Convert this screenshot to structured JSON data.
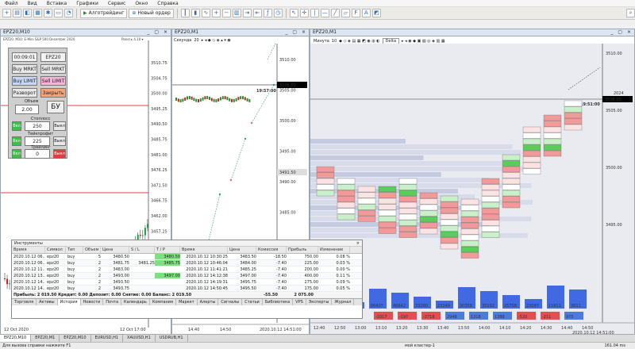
{
  "menu": [
    "Файл",
    "Вид",
    "Вставка",
    "Графики",
    "Сервис",
    "Окно",
    "Справка"
  ],
  "toolbar": {
    "algo_label": "Алготрейдинг",
    "new_order_label": "Новый ордер"
  },
  "windows": {
    "w1_title": "EPZ20,M10",
    "w1_sub": "EPZ20, M10: E-Mini S&P 500 December 2020",
    "w1_pane": "Panel ▸ 4.10 ▾",
    "w2_title": "EPZ20,M1",
    "w3_title": "EPZ20,M1"
  },
  "chart1": {
    "ticks": [
      "3510.75",
      "3504.75",
      "3500.00",
      "3495.25",
      "3490.50",
      "3485.75",
      "3481.00",
      "3476.25",
      "3471.50",
      "3466.75",
      "3462.00",
      "3457.25"
    ],
    "date": "12 Oct 2020",
    "bottom": "12 Oct 17:00"
  },
  "chart2": {
    "label_left": "Секунда",
    "val_left": "20",
    "ticks": [
      "3510.00",
      "3505.00",
      "3500.00",
      "3495.00",
      "3490.00",
      "3485.00"
    ],
    "price_label": "3506.00",
    "time_label": "19:57:00",
    "level_label": "3491.50",
    "bottom": [
      "14:40",
      "14:50",
      "2020.10.12 14:51:00"
    ]
  },
  "chart3": {
    "label_left": "Минута",
    "val_left": "10",
    "mode": "Delta",
    "ticks": [
      "3510.00",
      "3505.00",
      "3500.00",
      "3495.00"
    ],
    "price_label": "3506.00",
    "time_label": "19:51:00",
    "red_label": "2024",
    "lowhigh": "L: 3498.00  C: 3498.50",
    "vol_values": [
      "6394",
      "86437",
      "46642",
      "33280",
      "23249",
      "30358",
      "35192",
      "25758",
      "23097",
      "11611",
      "3611"
    ],
    "delta_values": [
      "-1017",
      "-197",
      "-3718",
      "2948",
      "1318",
      "1388",
      "-520",
      "-211",
      "975"
    ],
    "time_ticks": [
      "12:40",
      "12:50",
      "13:00",
      "13:10",
      "13:20",
      "13:30",
      "13:40",
      "13:50",
      "14:00",
      "14:10",
      "14:20",
      "14:30",
      "14:40",
      "14:50"
    ],
    "bottom_time": "2020.10.12 14:51:00"
  },
  "trade_panel": {
    "time": "00:09:01",
    "symbol": "EPZ20",
    "buy_mkt": "Buy MRKT",
    "sell_mkt": "Sell MRKT",
    "buy_limit": "Buy LIMIT",
    "sell_limit": "Sell LIMIT",
    "reverse": "Разворот",
    "close": "Закрыть",
    "volume_label": "Объем",
    "volume": "2.00",
    "be": "БУ",
    "stoploss_label": "Стоплосс",
    "stoploss": "250",
    "takeprofit_label": "Тейкпрофит",
    "takeprofit": "225",
    "trailing_label": "Трейлинг",
    "trailing": "0",
    "on": "Вкл",
    "off": "Выкл"
  },
  "terminal": {
    "title": "Инструменты",
    "headers": [
      "Время",
      "Символ",
      "Тип",
      "Объем",
      "Цена",
      "S / L",
      "T / P",
      "Время",
      "Цена",
      "Комиссия",
      "Прибыль",
      "Изменение"
    ],
    "rows": [
      [
        "2020.10.12 06...",
        "epz20",
        "buy",
        "5",
        "3480.50",
        "",
        "3480.50",
        "2020.10.12 10:30:25",
        "3483.50",
        "-18.50",
        "750.00",
        "0.08 %"
      ],
      [
        "2020.10.12 06...",
        "epz20",
        "buy",
        "2",
        "3481.75",
        "3481.25",
        "3485.75",
        "2020.10.12 10:46:04",
        "3484.00",
        "-7.40",
        "225.00",
        "0.03 %"
      ],
      [
        "2020.10.12 11...",
        "epz20",
        "buy",
        "2",
        "3483.00",
        "",
        "",
        "2020.10.12 11:41:21",
        "3485.25",
        "-7.40",
        "200.00",
        "0.00 %"
      ],
      [
        "2020.10.12 13...",
        "epz20",
        "buy",
        "2",
        "3493.00",
        "",
        "3497.00",
        "2020.10.12 14:12:38",
        "3497.00",
        "-7.40",
        "400.00",
        "0.11 %"
      ],
      [
        "2020.10.12 14...",
        "epz20",
        "buy",
        "2",
        "3493.50",
        "",
        "",
        "2020.10.12 14:19:31",
        "3495.75",
        "-7.40",
        "275.00",
        "0.09 %"
      ],
      [
        "2020.10.12 14...",
        "epz20",
        "buy",
        "2",
        "3493.75",
        "",
        "",
        "2020.10.12 14:50:45",
        "3495.50",
        "-7.40",
        "175.00",
        "0.05 %"
      ]
    ],
    "summary": "Прибыль: 2 019.50  Кредит: 0.00  Депозит: 0.00  Снятие: 0.00  Баланс: 2 019.50",
    "summary_comm": "-55.50",
    "summary_profit": "2 075.00",
    "tabs": [
      "Торговля",
      "Активы",
      "История",
      "Новости",
      "Почта",
      "Календарь",
      "Компания",
      "Маркет",
      "Алерты",
      "Сигналы",
      "Статьи",
      "Библиотека",
      "VPS",
      "Эксперты",
      "Журнал"
    ],
    "active_tab": 2
  },
  "window_tabs": [
    "EPZ20,M10",
    "EPZ20,M1",
    "EPZ20,M10",
    "EURUSD,H1",
    "XAUUSD,H1",
    "USDRUB,H1"
  ],
  "status": {
    "left": "Для вызова справки нажмите F1",
    "cluster": "мой кластер-1",
    "right": "161.04 ms"
  }
}
